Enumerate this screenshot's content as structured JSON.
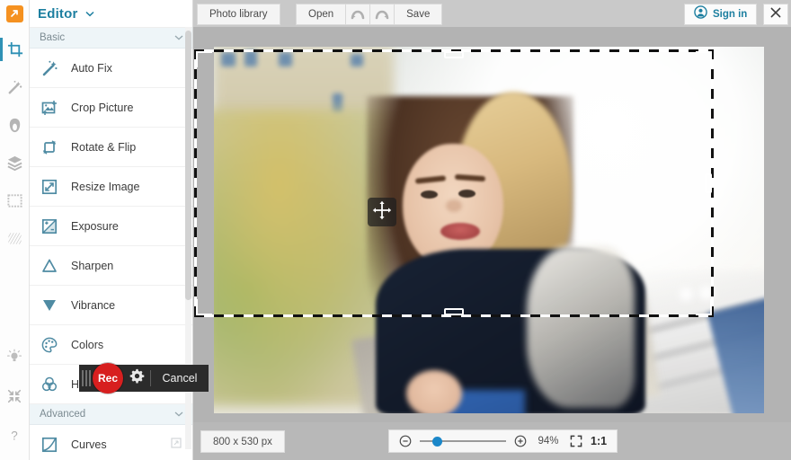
{
  "app": {
    "title": "Editor",
    "logo_icon": "orange-arrow-logo"
  },
  "rail": {
    "tools": [
      {
        "name": "crop-tool",
        "icon": "crop-icon",
        "active": true
      },
      {
        "name": "magic-wand-tool",
        "icon": "magic-wand-icon",
        "active": false
      },
      {
        "name": "portrait-tool",
        "icon": "portrait-icon",
        "active": false
      },
      {
        "name": "layers-tool",
        "icon": "layers-icon",
        "active": false
      },
      {
        "name": "frame-tool",
        "icon": "frame-icon",
        "active": false
      },
      {
        "name": "texture-tool",
        "icon": "texture-icon",
        "active": false
      }
    ],
    "bottom": [
      {
        "name": "tips-button",
        "icon": "lightbulb-icon"
      },
      {
        "name": "collapse-button",
        "icon": "collapse-arrows-icon"
      },
      {
        "name": "help-button",
        "icon": "question-mark-icon"
      }
    ]
  },
  "sidebar": {
    "groups": [
      {
        "label": "Basic",
        "items": [
          {
            "label": "Auto Fix",
            "icon": "magic-wand-icon"
          },
          {
            "label": "Crop Picture",
            "icon": "crop-picture-icon"
          },
          {
            "label": "Rotate & Flip",
            "icon": "rotate-flip-icon"
          },
          {
            "label": "Resize Image",
            "icon": "resize-icon"
          },
          {
            "label": "Exposure",
            "icon": "exposure-icon"
          },
          {
            "label": "Sharpen",
            "icon": "sharpen-triangle-icon"
          },
          {
            "label": "Vibrance",
            "icon": "vibrance-triangle-icon"
          },
          {
            "label": "Colors",
            "icon": "palette-icon"
          },
          {
            "label": "HDR",
            "icon": "hdr-venn-icon"
          }
        ]
      },
      {
        "label": "Advanced",
        "items": [
          {
            "label": "Curves",
            "icon": "curves-icon",
            "more": true
          }
        ]
      }
    ]
  },
  "toolbar": {
    "photo_library": "Photo library",
    "open": "Open",
    "undo_icon": "undo-arrow-icon",
    "redo_icon": "redo-arrow-icon",
    "save": "Save",
    "sign_in": "Sign in",
    "sign_in_icon": "user-avatar-icon",
    "close_icon": "close-x-icon"
  },
  "canvas": {
    "move_handle_icon": "move-four-arrows-icon",
    "selection": "crop-selection"
  },
  "recorder": {
    "rec_label": "Rec",
    "settings_icon": "gear-icon",
    "cancel_label": "Cancel"
  },
  "status": {
    "dimensions": "800 x 530 px",
    "zoom_out_icon": "zoom-out-circle-icon",
    "zoom_in_icon": "zoom-in-circle-icon",
    "zoom_percent": "94%",
    "fit_icon": "fit-screen-icon",
    "actual_size": "1:1"
  },
  "colors": {
    "accent_teal": "#1d7fa0",
    "logo_orange": "#f59120",
    "rec_red": "#d71f1f",
    "slider_blue": "#1b87c9"
  }
}
